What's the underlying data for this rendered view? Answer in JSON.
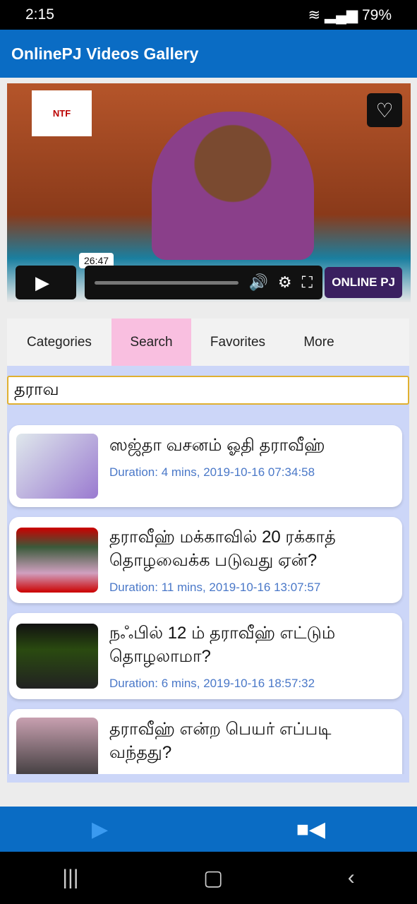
{
  "status_bar": {
    "time": "2:15",
    "battery": "79%",
    "icons": [
      "image-icon",
      "telegram-icon",
      "missed-call-icon",
      "wifi-icon",
      "volte-icon",
      "signal-icon",
      "battery-icon"
    ]
  },
  "app": {
    "title": "OnlinePJ Videos Gallery"
  },
  "player": {
    "logo": "NTF",
    "current_time": "26:47",
    "brand": "ONLINE PJ",
    "progress": 0
  },
  "tabs": [
    {
      "label": "Categories"
    },
    {
      "label": "Search",
      "active": true
    },
    {
      "label": "Favorites"
    },
    {
      "label": "More"
    }
  ],
  "search": {
    "value": "தராவ"
  },
  "results": [
    {
      "title": "ஸஜ்தா வசனம் ஓதி தராவீஹ்",
      "meta": "Duration: 4 mins, 2019-10-16 07:34:58"
    },
    {
      "title": "தராவீஹ் மக்காவில் 20 ரக்காத் தொழவைக்க படுவது ஏன்?",
      "meta": "Duration: 11 mins, 2019-10-16 13:07:57"
    },
    {
      "title": "நஃபில் 12 ம் தராவீஹ் எட்டும் தொழலாமா?",
      "meta": "Duration: 6 mins, 2019-10-16 18:57:32"
    },
    {
      "title": "தராவீஹ் என்ற பெயர் எப்படி வந்தது?",
      "meta": ""
    }
  ],
  "colors": {
    "accent": "#0a6cc4",
    "active_tab": "#f9bfe0",
    "meta_text": "#4a78c8"
  }
}
